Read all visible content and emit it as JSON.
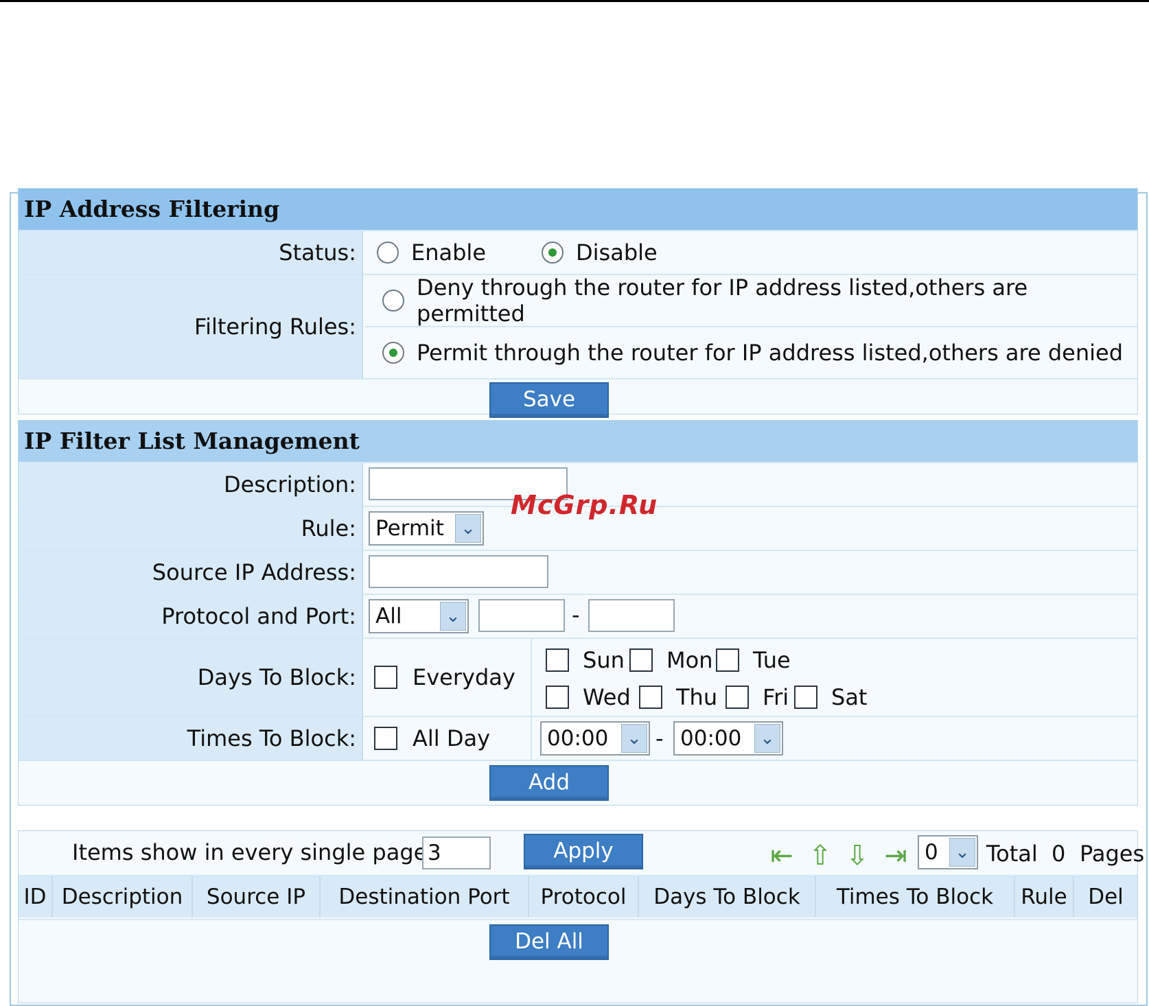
{
  "filtering": {
    "title": "IP Address Filtering",
    "status_label": "Status:",
    "status_enable": "Enable",
    "status_disable": "Disable",
    "rules_label": "Filtering Rules:",
    "rule_deny": "Deny through the router for IP address listed,others are permitted",
    "rule_permit": "Permit through the router for IP address listed,others are denied",
    "save_label": "Save"
  },
  "management": {
    "title": "IP Filter List Management",
    "description_label": "Description:",
    "description_value": "",
    "rule_label": "Rule:",
    "rule_value": "Permit",
    "source_ip_label": "Source IP Address:",
    "source_ip_value": "",
    "protocol_label": "Protocol and Port:",
    "protocol_value": "All",
    "port_separator": "-",
    "days_label": "Days To Block:",
    "everyday_label": "Everyday",
    "days": [
      "Sun",
      "Mon",
      "Tue",
      "Wed",
      "Thu",
      "Fri",
      "Sat"
    ],
    "times_label": "Times To Block:",
    "allday_label": "All Day",
    "time_start": "00:00",
    "time_end": "00:00",
    "time_separator": "-",
    "add_label": "Add"
  },
  "list": {
    "items_label": "Items show in every single page",
    "items_value": "3",
    "apply_label": "Apply",
    "page_value": "0",
    "total_label": "Total",
    "total_value": "0",
    "pages_label": "Pages",
    "columns": [
      "ID",
      "Description",
      "Source IP",
      "Destination Port",
      "Protocol",
      "Days To Block",
      "Times To Block",
      "Rule",
      "Del"
    ],
    "del_all_label": "Del All"
  },
  "watermark": "McGrp.Ru",
  "icons": [
    "radio-icon",
    "checkbox-icon",
    "first-page-icon",
    "prev-page-icon",
    "next-page-icon",
    "last-page-icon",
    "dropdown-arrow-icon"
  ]
}
